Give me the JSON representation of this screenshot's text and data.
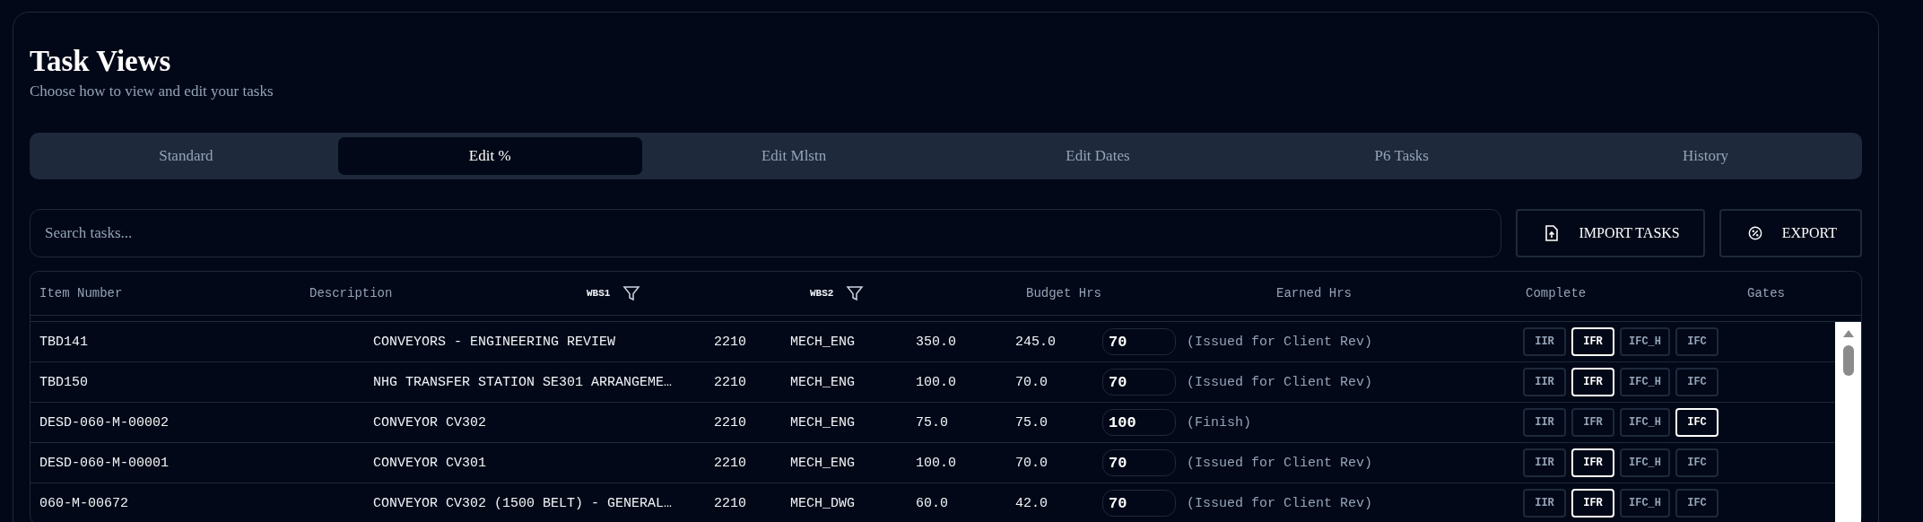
{
  "header": {
    "title": "Task Views",
    "subtitle": "Choose how to view and edit your tasks"
  },
  "tabs": [
    {
      "label": "Standard",
      "selected": false
    },
    {
      "label": "Edit %",
      "selected": true
    },
    {
      "label": "Edit Mlstn",
      "selected": false
    },
    {
      "label": "Edit Dates",
      "selected": false
    },
    {
      "label": "P6 Tasks",
      "selected": false
    },
    {
      "label": "History",
      "selected": false
    }
  ],
  "search": {
    "placeholder": "Search tasks..."
  },
  "actions": [
    {
      "label": "IMPORT TASKS",
      "kind": "import"
    },
    {
      "label": "EXPORT",
      "kind": "export"
    }
  ],
  "table": {
    "columns": [
      {
        "label": "Item Number",
        "filter": false
      },
      {
        "label": "Description",
        "filter": false
      },
      {
        "label": "WBS1",
        "filter": true
      },
      {
        "label": "WBS2",
        "filter": true
      },
      {
        "label": "Budget Hrs",
        "filter": false
      },
      {
        "label": "Earned Hrs",
        "filter": false
      },
      {
        "label": "Complete",
        "filter": false
      },
      {
        "label": "Gates",
        "filter": false
      }
    ],
    "rows": [
      {
        "item": "TBD141",
        "description": "CONVEYORS - ENGINEERING REVIEW",
        "wbs1": "2210",
        "wbs2": "MECH_ENG",
        "budget": "350.0",
        "earned": "245.0",
        "complete": "70",
        "status": "(Issued for Client Rev)",
        "gates": [
          {
            "label": "IIR",
            "selected": false
          },
          {
            "label": "IFR",
            "selected": true
          },
          {
            "label": "IFC_H",
            "selected": false
          },
          {
            "label": "IFC",
            "selected": false
          }
        ]
      },
      {
        "item": "TBD150",
        "description": "NHG TRANSFER STATION SE301 ARRANGEME…",
        "wbs1": "2210",
        "wbs2": "MECH_ENG",
        "budget": "100.0",
        "earned": "70.0",
        "complete": "70",
        "status": "(Issued for Client Rev)",
        "gates": [
          {
            "label": "IIR",
            "selected": false
          },
          {
            "label": "IFR",
            "selected": true
          },
          {
            "label": "IFC_H",
            "selected": false
          },
          {
            "label": "IFC",
            "selected": false
          }
        ]
      },
      {
        "item": "DESD-060-M-00002",
        "description": "CONVEYOR CV302",
        "wbs1": "2210",
        "wbs2": "MECH_ENG",
        "budget": "75.0",
        "earned": "75.0",
        "complete": "100",
        "status": "(Finish)",
        "gates": [
          {
            "label": "IIR",
            "selected": false
          },
          {
            "label": "IFR",
            "selected": false
          },
          {
            "label": "IFC_H",
            "selected": false
          },
          {
            "label": "IFC",
            "selected": true
          }
        ]
      },
      {
        "item": "DESD-060-M-00001",
        "description": "CONVEYOR CV301",
        "wbs1": "2210",
        "wbs2": "MECH_ENG",
        "budget": "100.0",
        "earned": "70.0",
        "complete": "70",
        "status": "(Issued for Client Rev)",
        "gates": [
          {
            "label": "IIR",
            "selected": false
          },
          {
            "label": "IFR",
            "selected": true
          },
          {
            "label": "IFC_H",
            "selected": false
          },
          {
            "label": "IFC",
            "selected": false
          }
        ]
      },
      {
        "item": "060-M-00672",
        "description": "CONVEYOR CV302 (1500 BELT) - GENERAL…",
        "wbs1": "2210",
        "wbs2": "MECH_DWG",
        "budget": "60.0",
        "earned": "42.0",
        "complete": "70",
        "status": "(Issued for Client Rev)",
        "gates": [
          {
            "label": "IIR",
            "selected": false
          },
          {
            "label": "IFR",
            "selected": true
          },
          {
            "label": "IFC_H",
            "selected": false
          },
          {
            "label": "IFC",
            "selected": false
          }
        ]
      }
    ]
  }
}
